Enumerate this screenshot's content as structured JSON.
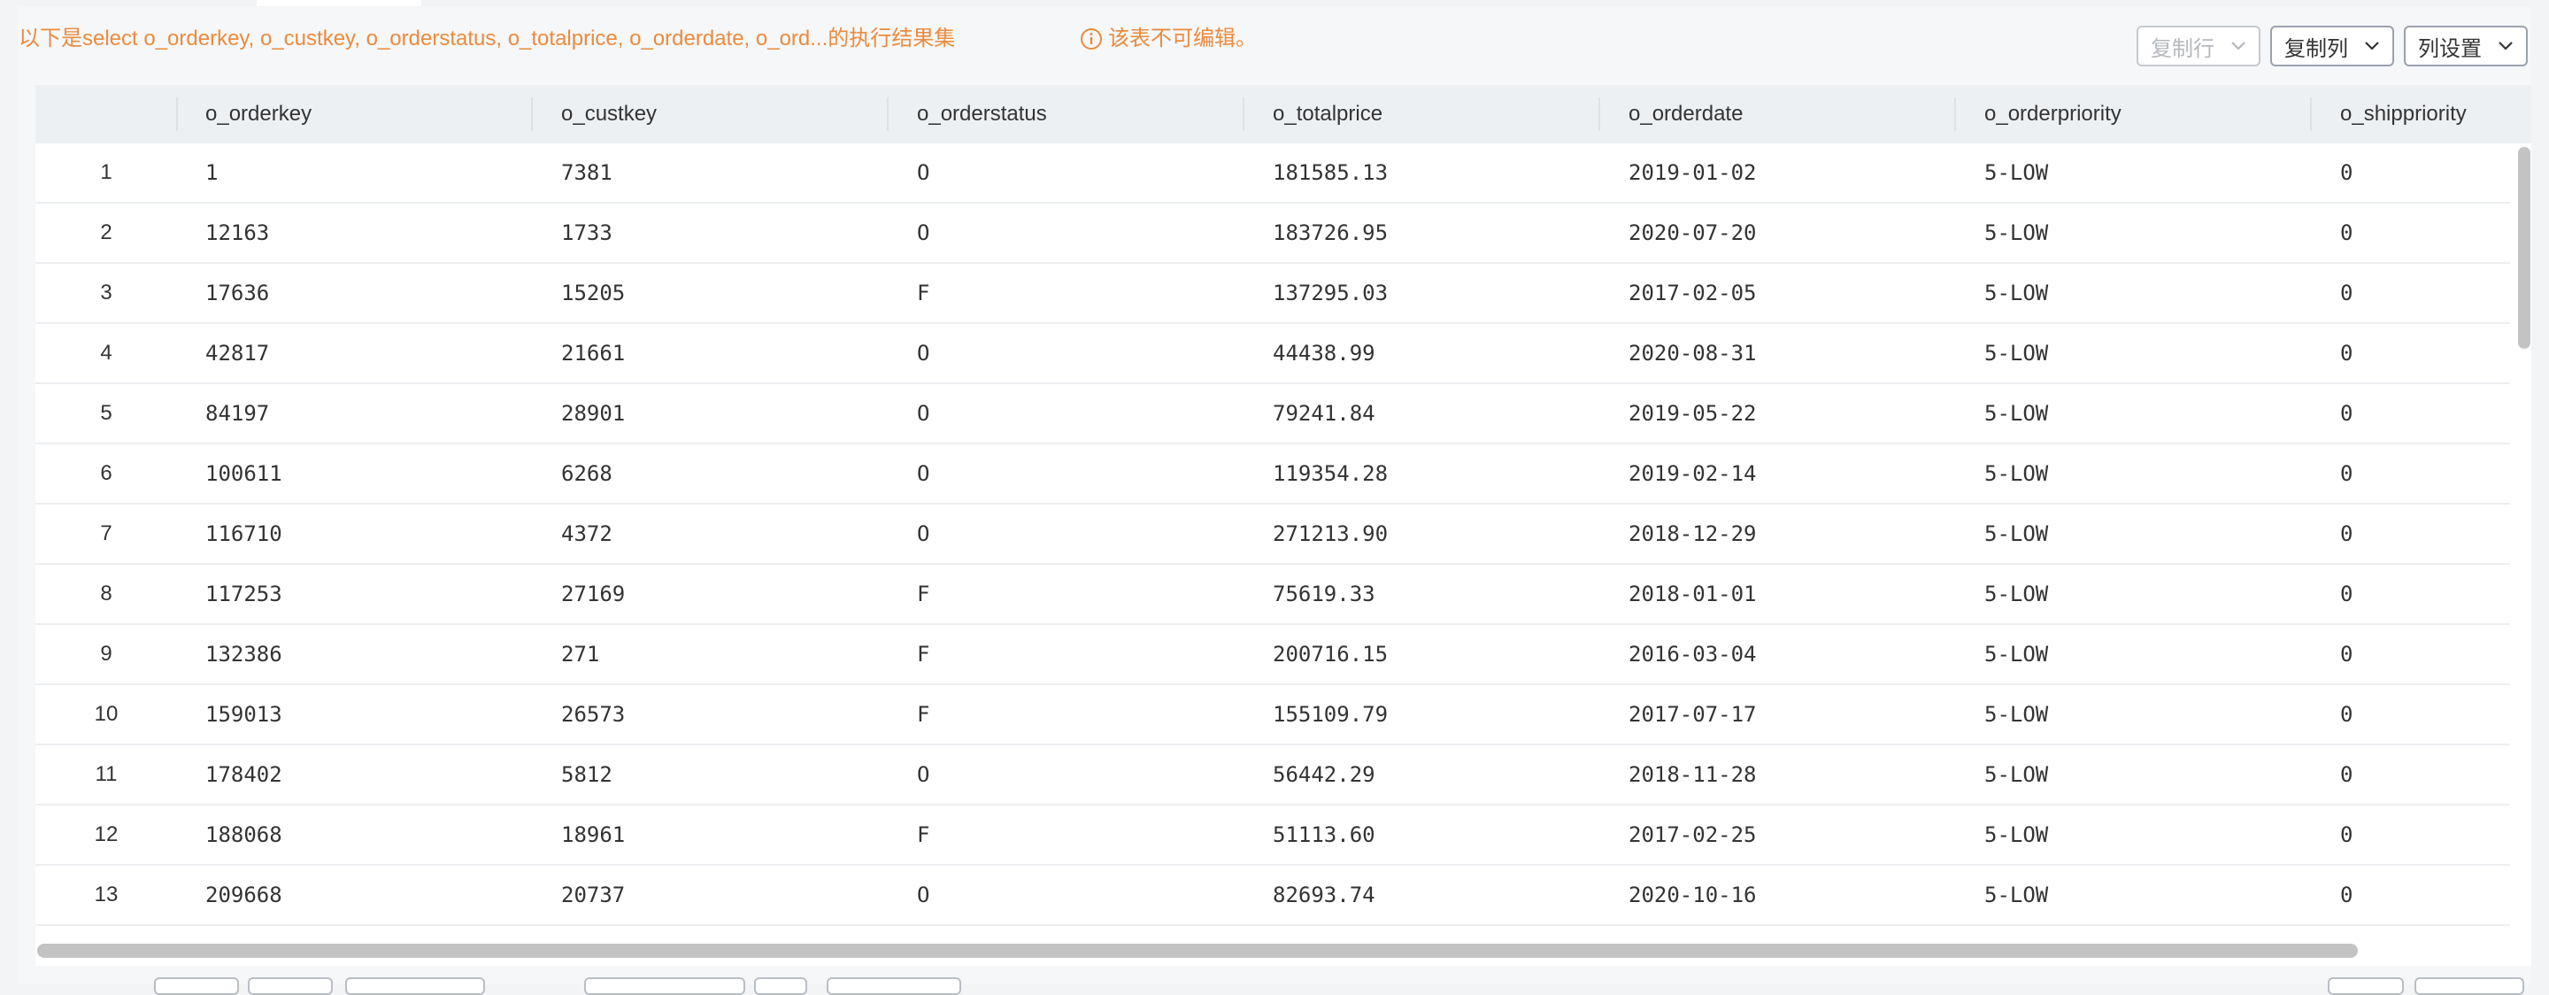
{
  "notice": {
    "result_text": "以下是select o_orderkey, o_custkey, o_orderstatus, o_totalprice, o_orderdate, o_ord...的执行结果集",
    "readonly_text": "该表不可编辑。"
  },
  "toolbar": {
    "copy_row_label": "复制行",
    "copy_col_label": "复制列",
    "col_settings_label": "列设置"
  },
  "table": {
    "columns": [
      "o_orderkey",
      "o_custkey",
      "o_orderstatus",
      "o_totalprice",
      "o_orderdate",
      "o_orderpriority",
      "o_shippriority"
    ],
    "rows": [
      {
        "idx": "1",
        "o_orderkey": "1",
        "o_custkey": "7381",
        "o_orderstatus": "O",
        "o_totalprice": "181585.13",
        "o_orderdate": "2019-01-02",
        "o_orderpriority": "5-LOW",
        "o_shippriority": "0"
      },
      {
        "idx": "2",
        "o_orderkey": "12163",
        "o_custkey": "1733",
        "o_orderstatus": "O",
        "o_totalprice": "183726.95",
        "o_orderdate": "2020-07-20",
        "o_orderpriority": "5-LOW",
        "o_shippriority": "0"
      },
      {
        "idx": "3",
        "o_orderkey": "17636",
        "o_custkey": "15205",
        "o_orderstatus": "F",
        "o_totalprice": "137295.03",
        "o_orderdate": "2017-02-05",
        "o_orderpriority": "5-LOW",
        "o_shippriority": "0"
      },
      {
        "idx": "4",
        "o_orderkey": "42817",
        "o_custkey": "21661",
        "o_orderstatus": "O",
        "o_totalprice": "44438.99",
        "o_orderdate": "2020-08-31",
        "o_orderpriority": "5-LOW",
        "o_shippriority": "0"
      },
      {
        "idx": "5",
        "o_orderkey": "84197",
        "o_custkey": "28901",
        "o_orderstatus": "O",
        "o_totalprice": "79241.84",
        "o_orderdate": "2019-05-22",
        "o_orderpriority": "5-LOW",
        "o_shippriority": "0"
      },
      {
        "idx": "6",
        "o_orderkey": "100611",
        "o_custkey": "6268",
        "o_orderstatus": "O",
        "o_totalprice": "119354.28",
        "o_orderdate": "2019-02-14",
        "o_orderpriority": "5-LOW",
        "o_shippriority": "0"
      },
      {
        "idx": "7",
        "o_orderkey": "116710",
        "o_custkey": "4372",
        "o_orderstatus": "O",
        "o_totalprice": "271213.90",
        "o_orderdate": "2018-12-29",
        "o_orderpriority": "5-LOW",
        "o_shippriority": "0"
      },
      {
        "idx": "8",
        "o_orderkey": "117253",
        "o_custkey": "27169",
        "o_orderstatus": "F",
        "o_totalprice": "75619.33",
        "o_orderdate": "2018-01-01",
        "o_orderpriority": "5-LOW",
        "o_shippriority": "0"
      },
      {
        "idx": "9",
        "o_orderkey": "132386",
        "o_custkey": "271",
        "o_orderstatus": "F",
        "o_totalprice": "200716.15",
        "o_orderdate": "2016-03-04",
        "o_orderpriority": "5-LOW",
        "o_shippriority": "0"
      },
      {
        "idx": "10",
        "o_orderkey": "159013",
        "o_custkey": "26573",
        "o_orderstatus": "F",
        "o_totalprice": "155109.79",
        "o_orderdate": "2017-07-17",
        "o_orderpriority": "5-LOW",
        "o_shippriority": "0"
      },
      {
        "idx": "11",
        "o_orderkey": "178402",
        "o_custkey": "5812",
        "o_orderstatus": "O",
        "o_totalprice": "56442.29",
        "o_orderdate": "2018-11-28",
        "o_orderpriority": "5-LOW",
        "o_shippriority": "0"
      },
      {
        "idx": "12",
        "o_orderkey": "188068",
        "o_custkey": "18961",
        "o_orderstatus": "F",
        "o_totalprice": "51113.60",
        "o_orderdate": "2017-02-25",
        "o_orderpriority": "5-LOW",
        "o_shippriority": "0"
      },
      {
        "idx": "13",
        "o_orderkey": "209668",
        "o_custkey": "20737",
        "o_orderstatus": "O",
        "o_totalprice": "82693.74",
        "o_orderdate": "2020-10-16",
        "o_orderpriority": "5-LOW",
        "o_shippriority": "0"
      }
    ]
  },
  "colors": {
    "notice": "#ea8b3d",
    "header_bg": "#edf0f3",
    "border": "#9aa2ad"
  },
  "icons": {
    "info": "info-circle-icon",
    "dropdown": "chevron-down-icon"
  }
}
